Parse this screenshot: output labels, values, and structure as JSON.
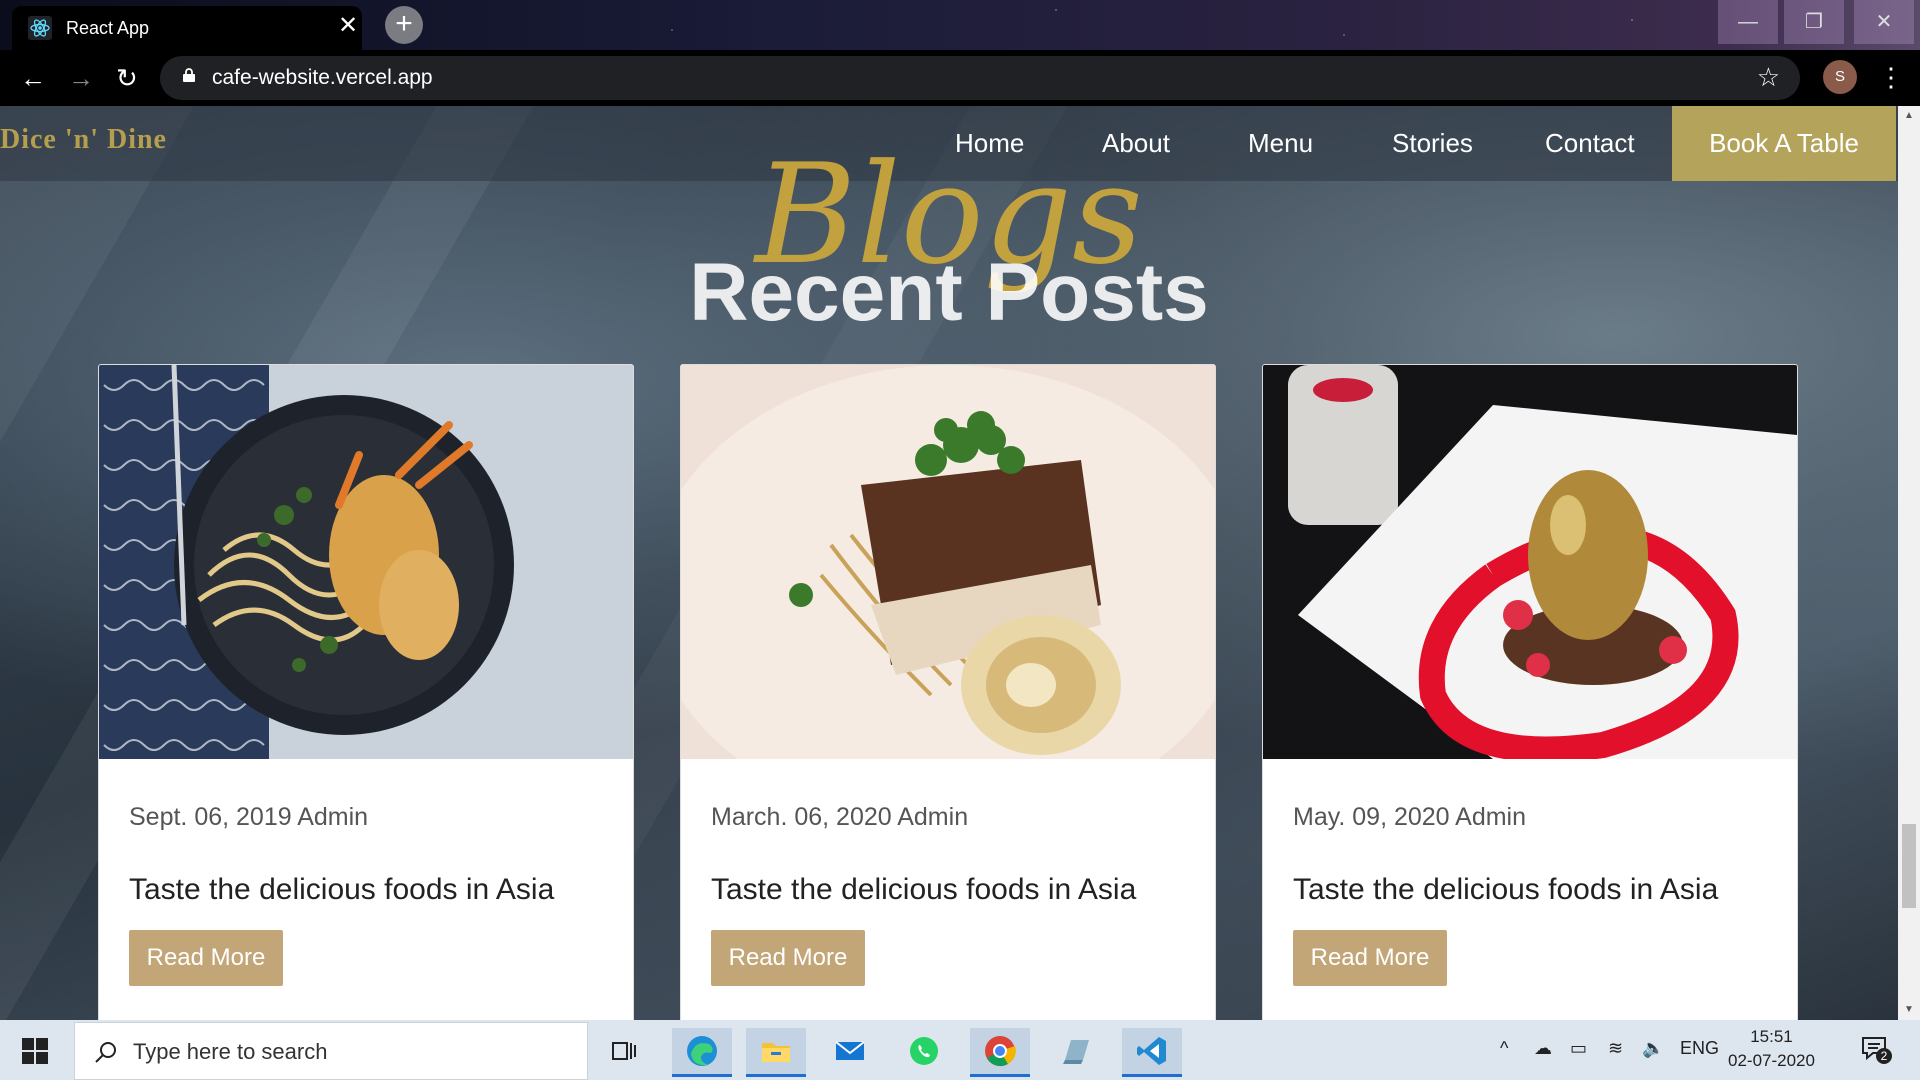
{
  "browser": {
    "tab_title": "React App",
    "tab_close": "✕",
    "new_tab": "+",
    "url": "cafe-website.vercel.app",
    "profile_initial": "S",
    "window_controls": {
      "minimize": "—",
      "restore": "❐",
      "close": "✕"
    }
  },
  "site": {
    "brand": "Dice 'n' Dine",
    "nav": [
      "Home",
      "About",
      "Menu",
      "Stories",
      "Contact"
    ],
    "cta": "Book A Table",
    "section_script": "Blogs",
    "section_title": "Recent Posts",
    "cards": [
      {
        "meta": "Sept. 06, 2019 Admin",
        "title": "Taste the delicious foods in Asia",
        "button": "Read More"
      },
      {
        "meta": "March. 06, 2020 Admin",
        "title": "Taste the delicious foods in Asia",
        "button": "Read More"
      },
      {
        "meta": "May. 09, 2020 Admin",
        "title": "Taste the delicious foods in Asia",
        "button": "Read More"
      }
    ]
  },
  "taskbar": {
    "search_placeholder": "Type here to search",
    "language": "ENG",
    "time": "15:51",
    "date": "02-07-2020",
    "notification_count": "2"
  },
  "colors": {
    "brand_gold": "#b59f4e",
    "cta_gold": "#b4a35a",
    "button_tan": "#c2a677"
  }
}
